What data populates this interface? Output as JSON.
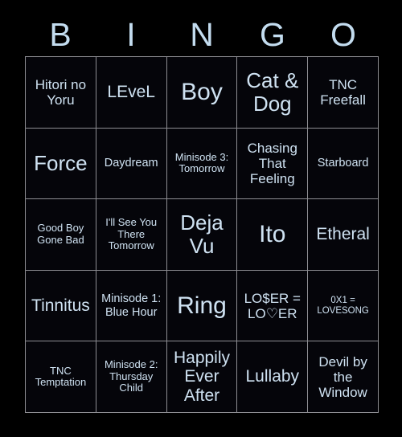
{
  "card": {
    "title": "BINGO",
    "header_letters": [
      "B",
      "I",
      "N",
      "G",
      "O"
    ],
    "colors": {
      "background": "#000000",
      "cell_background": "#05050a",
      "grid_line": "#8d8d92",
      "text": "#cfe2f2",
      "header_text": "#c3dcef"
    },
    "grid": {
      "rows": 5,
      "columns": 5,
      "cells": [
        {
          "text": "Hitori no Yoru",
          "size": "fs-l"
        },
        {
          "text": "LEveL",
          "size": "fs-xl"
        },
        {
          "text": "Boy",
          "size": "fs-hg"
        },
        {
          "text": "Cat & Dog",
          "size": "fs-xxl"
        },
        {
          "text": "TNC Freefall",
          "size": "fs-l"
        },
        {
          "text": "Force",
          "size": "fs-xxl"
        },
        {
          "text": "Daydream",
          "size": "fs-m"
        },
        {
          "text": "Minisode 3: Tomorrow",
          "size": "fs-s"
        },
        {
          "text": "Chasing That Feeling",
          "size": "fs-l"
        },
        {
          "text": "Starboard",
          "size": "fs-m"
        },
        {
          "text": "Good Boy Gone Bad",
          "size": "fs-s"
        },
        {
          "text": "I'll See You There Tomorrow",
          "size": "fs-s"
        },
        {
          "text": "Deja Vu",
          "size": "fs-xxl"
        },
        {
          "text": "Ito",
          "size": "fs-hg"
        },
        {
          "text": "Etheral",
          "size": "fs-xl"
        },
        {
          "text": "Tinnitus",
          "size": "fs-xl"
        },
        {
          "text": "Minisode 1: Blue Hour",
          "size": "fs-m"
        },
        {
          "text": "Ring",
          "size": "fs-hg"
        },
        {
          "text": "LO$ER = LO♡ER",
          "size": "fs-l"
        },
        {
          "text": "0X1 = LOVESONG",
          "size": "fs-xs"
        },
        {
          "text": "TNC Temptation",
          "size": "fs-s"
        },
        {
          "text": "Minisode 2: Thursday Child",
          "size": "fs-s"
        },
        {
          "text": "Happily Ever After",
          "size": "fs-xl"
        },
        {
          "text": "Lullaby",
          "size": "fs-xl"
        },
        {
          "text": "Devil by the Window",
          "size": "fs-l"
        }
      ]
    }
  }
}
